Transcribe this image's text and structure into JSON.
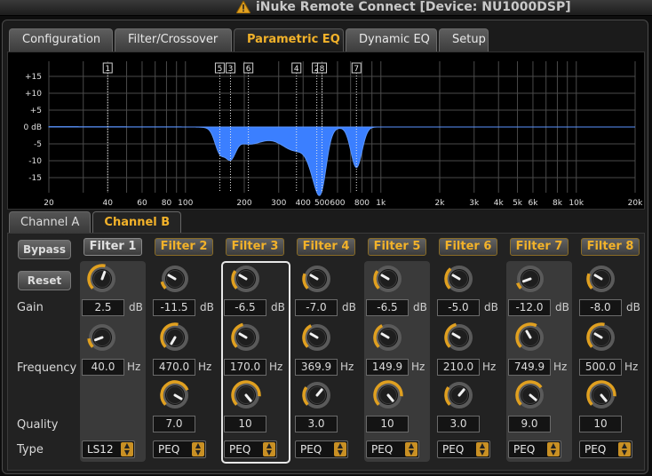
{
  "window": {
    "title": "iNuke Remote Connect [Device: NU1000DSP]"
  },
  "tabs": [
    {
      "label": "Configuration",
      "active": false
    },
    {
      "label": "Filter/Crossover",
      "active": false
    },
    {
      "label": "Parametric EQ",
      "active": true
    },
    {
      "label": "Dynamic EQ",
      "active": false
    },
    {
      "label": "Setup",
      "active": false
    }
  ],
  "graph": {
    "y_ticks": [
      "+15",
      "+10",
      "+5",
      "0 dB",
      "-5",
      "-10",
      "-15"
    ],
    "x_ticks": [
      "20",
      "40",
      "60",
      "80",
      "100",
      "200",
      "300",
      "400",
      "500",
      "600",
      "800",
      "1k",
      "2k",
      "3k",
      "4k",
      "5k",
      "6k",
      "8k",
      "10k",
      "20k"
    ],
    "markers": [
      "1",
      "5",
      "3",
      "6",
      "4",
      "2",
      "8",
      "7"
    ]
  },
  "channels": [
    {
      "label": "Channel A",
      "active": false
    },
    {
      "label": "Channel B",
      "active": true
    }
  ],
  "controls": {
    "bypass": "Bypass",
    "reset": "Reset",
    "gain_label": "Gain",
    "frequency_label": "Frequency",
    "quality_label": "Quality",
    "type_label": "Type",
    "db_unit": "dB",
    "hz_unit": "Hz"
  },
  "filters": [
    {
      "name": "Filter 1",
      "enabled": false,
      "gain": "2.5",
      "freq": "40.0",
      "q": "",
      "type": "LS12"
    },
    {
      "name": "Filter 2",
      "enabled": true,
      "gain": "-11.5",
      "freq": "470.0",
      "q": "7.0",
      "type": "PEQ"
    },
    {
      "name": "Filter 3",
      "enabled": true,
      "gain": "-6.5",
      "freq": "170.0",
      "q": "10",
      "type": "PEQ"
    },
    {
      "name": "Filter 4",
      "enabled": true,
      "gain": "-7.0",
      "freq": "369.9",
      "q": "3.0",
      "type": "PEQ"
    },
    {
      "name": "Filter 5",
      "enabled": true,
      "gain": "-6.5",
      "freq": "149.9",
      "q": "10",
      "type": "PEQ"
    },
    {
      "name": "Filter 6",
      "enabled": true,
      "gain": "-5.0",
      "freq": "210.0",
      "q": "3.0",
      "type": "PEQ"
    },
    {
      "name": "Filter 7",
      "enabled": true,
      "gain": "-12.0",
      "freq": "749.9",
      "q": "9.0",
      "type": "PEQ"
    },
    {
      "name": "Filter 8",
      "enabled": true,
      "gain": "-8.0",
      "freq": "500.0",
      "q": "10",
      "type": "PEQ"
    }
  ],
  "colors": {
    "accent": "#f2b22a",
    "curve": "#3b7fff",
    "selected_border": "#e8e8e8"
  }
}
